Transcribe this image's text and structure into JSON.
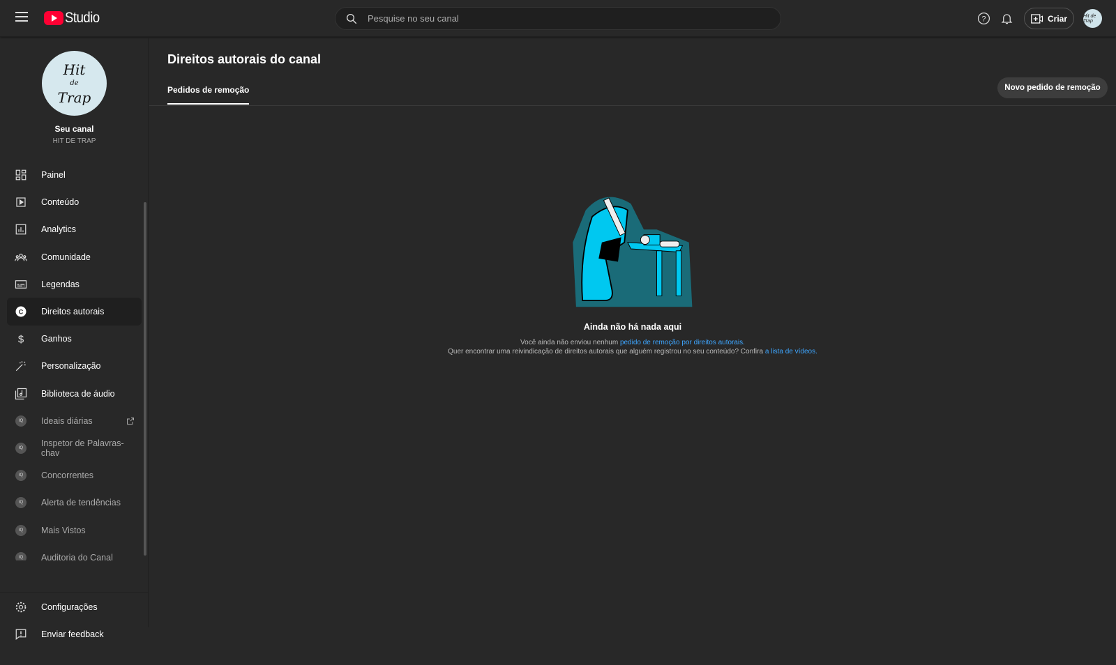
{
  "header": {
    "logo_text": "Studio",
    "search_placeholder": "Pesquise no seu canal",
    "create_label": "Criar",
    "avatar_text": "Hit de Trap"
  },
  "channel": {
    "logo_line1": "Hit",
    "logo_line2": "de",
    "logo_line3": "Trap",
    "title": "Seu canal",
    "name": "HIT DE TRAP"
  },
  "nav": [
    {
      "label": "Painel",
      "icon": "dashboard-icon"
    },
    {
      "label": "Conteúdo",
      "icon": "content-icon"
    },
    {
      "label": "Analytics",
      "icon": "analytics-icon"
    },
    {
      "label": "Comunidade",
      "icon": "community-icon"
    },
    {
      "label": "Legendas",
      "icon": "subtitles-icon"
    },
    {
      "label": "Direitos autorais",
      "icon": "copyright-icon",
      "active": true
    },
    {
      "label": "Ganhos",
      "icon": "dollar-icon"
    },
    {
      "label": "Personalização",
      "icon": "magic-wand-icon"
    },
    {
      "label": "Biblioteca de áudio",
      "icon": "audio-library-icon"
    },
    {
      "label": "Ideais diárias",
      "icon": "extension-icon"
    },
    {
      "label": "Inspetor de Palavras-chav",
      "icon": "extension-icon"
    },
    {
      "label": "Concorrentes",
      "icon": "extension-icon"
    },
    {
      "label": "Alerta de tendências",
      "icon": "extension-icon"
    },
    {
      "label": "Mais Vistos",
      "icon": "extension-icon"
    },
    {
      "label": "Auditoria do Canal",
      "icon": "extension-icon"
    }
  ],
  "bottom_nav": [
    {
      "label": "Configurações"
    },
    {
      "label": "Enviar feedback"
    }
  ],
  "main": {
    "title": "Direitos autorais do canal",
    "tab": "Pedidos de remoção",
    "new_request": "Novo pedido de remoção",
    "empty_title": "Ainda não há nada aqui",
    "line1_prefix": "Você ainda não enviou nenhum ",
    "line1_link": "pedido de remoção por direitos autorais.",
    "line2_prefix": "Quer encontrar uma reivindicação de direitos autorais que alguém registrou no seu conteúdo? Confira ",
    "line2_link": "a lista de vídeos."
  },
  "colors": {
    "accent": "#3ea6ff",
    "brand": "#ff0033",
    "illustration": "#00c8f0"
  }
}
